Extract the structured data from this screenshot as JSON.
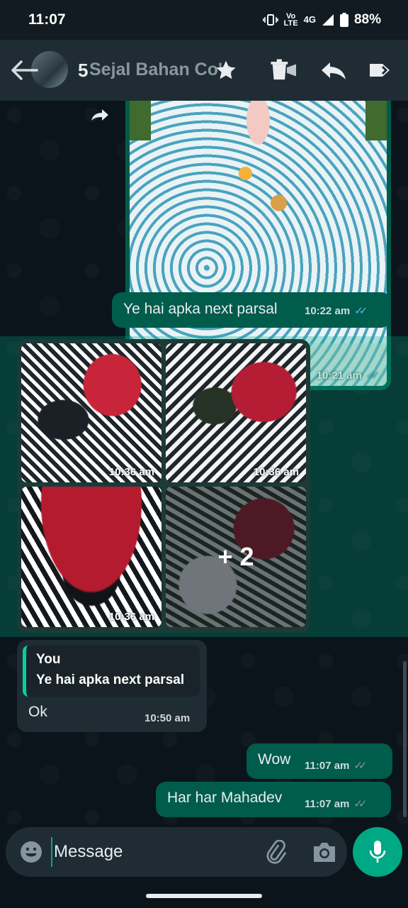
{
  "status_bar": {
    "time": "11:07",
    "network_top": "Vo",
    "network_bottom": "LTE",
    "network_type": "4G",
    "battery": "88%"
  },
  "app_bar": {
    "selected_count": "5",
    "chat_name": "Sejal Bahan Co's"
  },
  "icons": {
    "back": "arrow-left-icon",
    "star": "star-icon",
    "delete": "trash-icon",
    "reply": "reply-icon",
    "forward": "forward-icon",
    "emoji": "emoji-icon",
    "attach": "paperclip-icon",
    "camera": "camera-icon",
    "mic": "mic-icon"
  },
  "colors": {
    "outgoing_bubble": "#005c4b",
    "incoming_bubble": "#202c33",
    "accent": "#00a884",
    "read_ticks": "#53bdeb"
  },
  "messages": [
    {
      "type": "image",
      "direction": "out",
      "time": "10:21 am",
      "status": "read"
    },
    {
      "type": "text",
      "direction": "out",
      "text": "Ye hai apka next parsal",
      "time": "10:22 am",
      "status": "read"
    },
    {
      "type": "album",
      "direction": "in",
      "selected": true,
      "photos": [
        {
          "time": "10:36 am"
        },
        {
          "time": "10:36 am"
        },
        {
          "time": "10:36 am"
        },
        {
          "more_label": "+ 2"
        }
      ]
    },
    {
      "type": "reply",
      "direction": "in",
      "quote_author": "You",
      "quote_text": "Ye hai apka next parsal",
      "text": "Ok",
      "time": "10:50 am"
    },
    {
      "type": "text",
      "direction": "out",
      "text": "Wow",
      "time": "11:07 am",
      "status": "delivered"
    },
    {
      "type": "text",
      "direction": "out",
      "text": "Har har Mahadev",
      "time": "11:07 am",
      "status": "delivered"
    }
  ],
  "input": {
    "placeholder": "Message",
    "value": ""
  }
}
